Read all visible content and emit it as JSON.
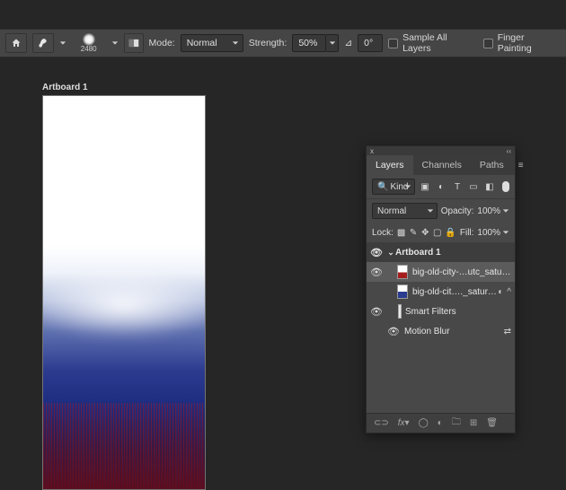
{
  "optionsBar": {
    "brushSize": "2480",
    "modeLabel": "Mode:",
    "modeValue": "Normal",
    "strengthLabel": "Strength:",
    "strengthValue": "50%",
    "angleIcon": "⊿",
    "angleValue": "0°",
    "sampleAllLabel": "Sample All Layers",
    "fingerPaintLabel": "Finger Painting"
  },
  "canvas": {
    "artboardLabel": "Artboard 1"
  },
  "layersPanel": {
    "close": "x",
    "collapse": "‹‹",
    "tabs": {
      "layers": "Layers",
      "channels": "Channels",
      "paths": "Paths"
    },
    "filterKind": "Kind",
    "blendMode": "Normal",
    "opacityLabel": "Opacity:",
    "opacityValue": "100%",
    "lockLabel": "Lock:",
    "fillLabel": "Fill:",
    "fillValue": "100%",
    "artboardName": "Artboard 1",
    "layer1": "big-old-city-…utc_saturated",
    "layer2": "big-old-cit…._saturated",
    "smartFilters": "Smart Filters",
    "motionBlur": "Motion Blur"
  }
}
